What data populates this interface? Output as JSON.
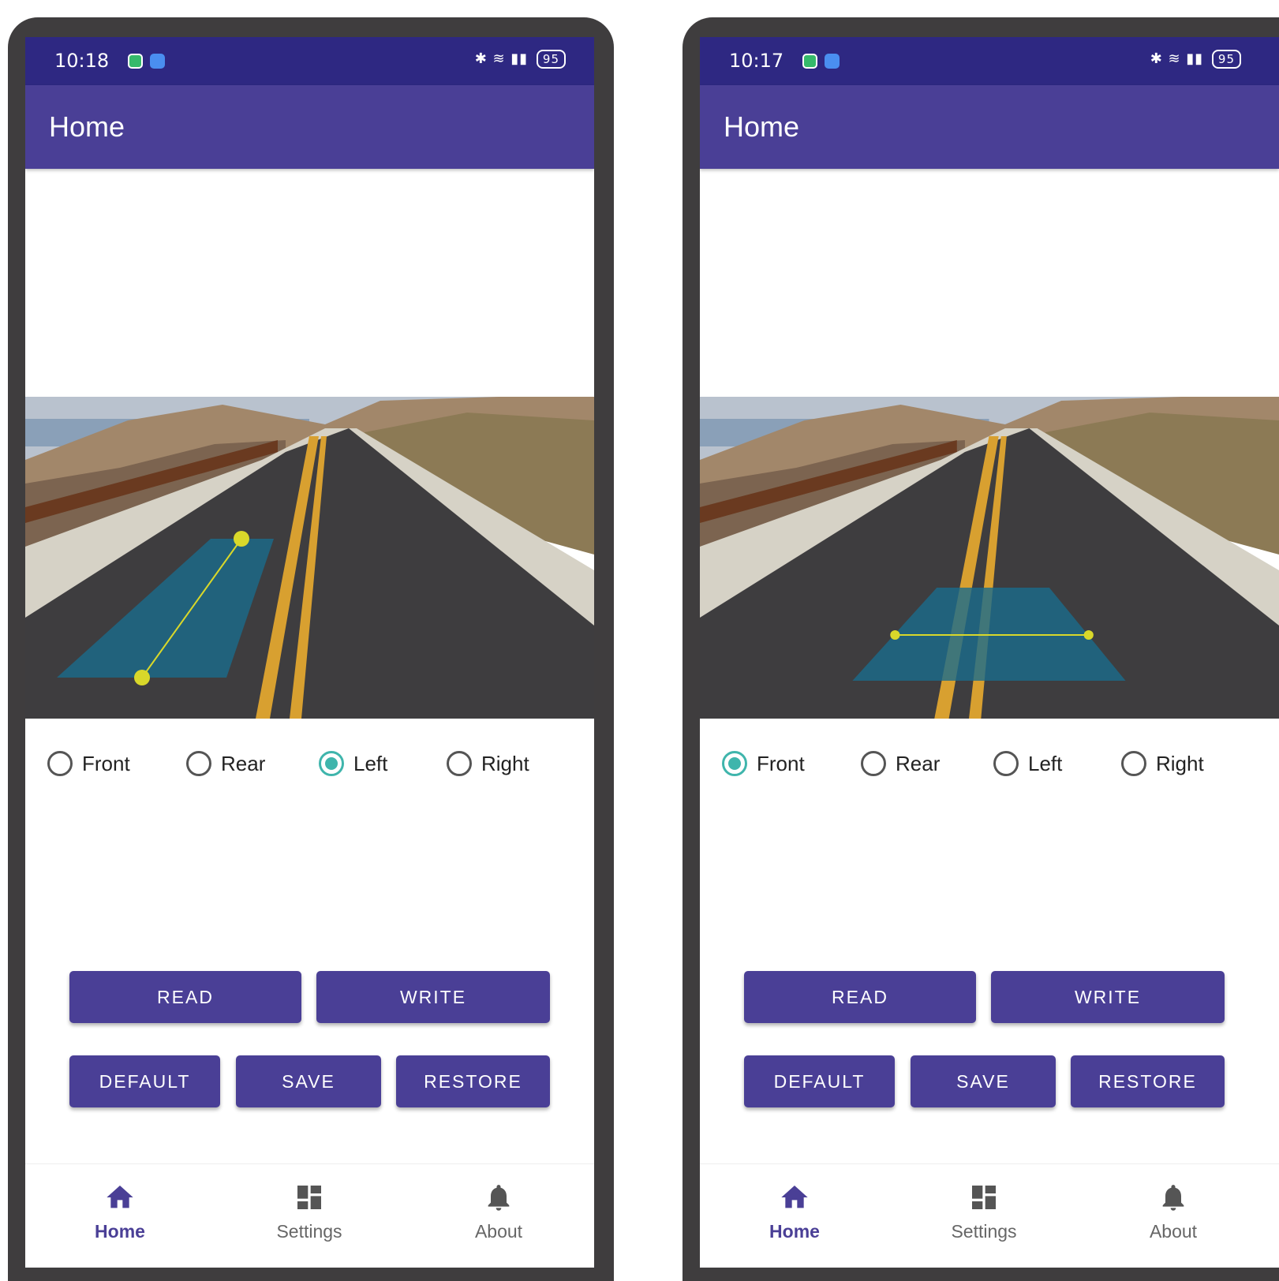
{
  "colors": {
    "statusbar": "#2e2882",
    "appbar": "#4a3f96",
    "accent_radio": "#3fb5ac",
    "overlay": "#1a6c8c",
    "handle": "#d9d82a"
  },
  "screens": [
    {
      "status": {
        "time": "10:18",
        "battery": "95"
      },
      "title": "Home",
      "radios": [
        {
          "label": "Front",
          "checked": false
        },
        {
          "label": "Rear",
          "checked": false
        },
        {
          "label": "Left",
          "checked": true
        },
        {
          "label": "Right",
          "checked": false
        }
      ],
      "buttons": {
        "read": "READ",
        "write": "WRITE",
        "default": "DEFAULT",
        "save": "SAVE",
        "restore": "RESTORE"
      },
      "nav": [
        {
          "label": "Home",
          "icon": "home-icon",
          "active": true
        },
        {
          "label": "Settings",
          "icon": "dashboard-icon",
          "active": false
        },
        {
          "label": "About",
          "icon": "bell-icon",
          "active": false
        }
      ]
    },
    {
      "status": {
        "time": "10:17",
        "battery": "95"
      },
      "title": "Home",
      "radios": [
        {
          "label": "Front",
          "checked": true
        },
        {
          "label": "Rear",
          "checked": false
        },
        {
          "label": "Left",
          "checked": false
        },
        {
          "label": "Right",
          "checked": false
        }
      ],
      "buttons": {
        "read": "READ",
        "write": "WRITE",
        "default": "DEFAULT",
        "save": "SAVE",
        "restore": "RESTORE"
      },
      "nav": [
        {
          "label": "Home",
          "icon": "home-icon",
          "active": true
        },
        {
          "label": "Settings",
          "icon": "dashboard-icon",
          "active": false
        },
        {
          "label": "About",
          "icon": "bell-icon",
          "active": false
        }
      ]
    }
  ]
}
